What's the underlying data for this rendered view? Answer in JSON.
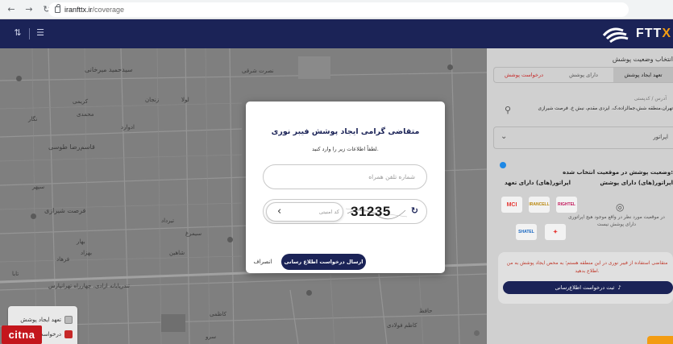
{
  "browser": {
    "url_host": "iranfttx.ir",
    "url_path": "/coverage"
  },
  "map": {
    "streets": [
      "سیدحمید میرخانی",
      "نصرت شرقی",
      "کریمی",
      "زنجان",
      "لولا",
      "محمدی",
      "ادوارد",
      "قاسم‌رضا طوسی",
      "نگار",
      "فرصت شیرازی",
      "فرهاد",
      "بهار",
      "بهزاد",
      "تیرداد",
      "شاهین",
      "سپهر",
      "سیمرغ",
      "تابا",
      "تندرپایانه ازادی، چهارراه تهرانپارس",
      "کاظمی",
      "کاظم فولادی",
      "حافظ",
      "سرو"
    ],
    "legend": {
      "item1": "تعهد ایجاد پوشش",
      "item2": "درخواست پوشش"
    },
    "watermark": "citna"
  },
  "sidebar": {
    "title": "انتخاب وضعیت پوشش",
    "tabs": [
      "تعهد ایجاد پوشش",
      "دارای پوشش",
      "درخواست پوشش"
    ],
    "address_label": "آدرس / کدپستی",
    "address_value": "تهران،منطقه شش،جمالزاده،ک. ایزدی مقدم، نبش خ. فرصت شیرازی",
    "operator_select": "اپراتور",
    "coverage_title": "وضعیت پوشش در موقعیت انتخاب شده:",
    "covered_header": "اپراتور(های) دارای پوشش",
    "commit_header": "اپراتور(های) دارای تعهد",
    "operators": [
      "MCI",
      "IRANCELL",
      "RIGHTEL",
      "SHATEL"
    ],
    "no_coverage_text": "در موقعیت مورد نظر در واقع موجود هیچ اپراتوری دارای پوشش نیست",
    "request_text": "متقاضی استفاده از فیبر نوری در این منطقه هستم؛ به محض ایجاد پوشش به من اطلاع بدهید.",
    "request_button": "ثبت درخواست اطلاع‌رسانی"
  },
  "modal": {
    "title": "متقاضی گرامی ایجاد پوشش فیبر نوری",
    "subtitle": "لطفاً اطلاعات زیر را وارد کنید.",
    "phone_placeholder": "شماره تلفن همراه",
    "captcha_value": "31235",
    "code_placeholder": "کد امنیتی",
    "submit_label": "ارسال درخواست اطلاع رسانی",
    "cancel_label": "انصراف"
  },
  "colors": {
    "brand": "#1b2357",
    "accent": "#f39c12",
    "map_bg": "#7f7f7f"
  }
}
